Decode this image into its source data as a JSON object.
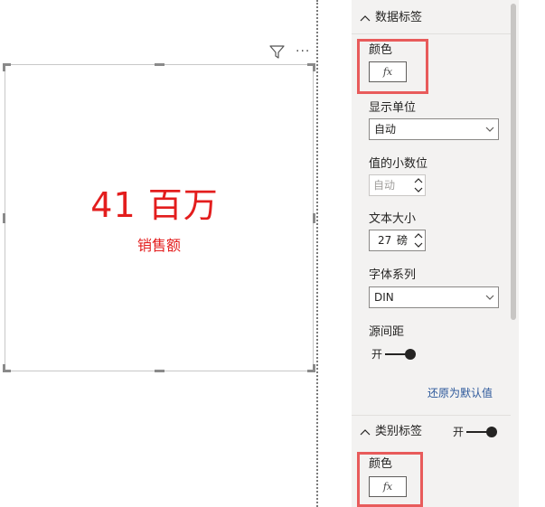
{
  "card": {
    "value": "41 百万",
    "label": "销售额",
    "value_color": "#e31d1d",
    "filter_icon": "filter-icon",
    "more_icon": "more-options-icon",
    "more_glyph": "···"
  },
  "format_pane": {
    "data_labels": {
      "title": "数据标签",
      "color_label": "颜色",
      "fx_label": "fx",
      "display_units_label": "显示单位",
      "display_units_value": "自动",
      "decimals_label": "值的小数位",
      "decimals_placeholder": "自动",
      "text_size_label": "文本大小",
      "text_size_value": "27",
      "text_size_unit": "磅",
      "font_family_label": "字体系列",
      "font_family_value": "DIN",
      "spacing_label": "源间距",
      "spacing_toggle_label": "开",
      "reset_label": "还原为默认值"
    },
    "category_labels": {
      "title": "类别标签",
      "toggle_label": "开",
      "color_label": "颜色",
      "fx_label": "fx"
    },
    "highlight_color": "#e85b5b",
    "link_color": "#2b579a"
  }
}
